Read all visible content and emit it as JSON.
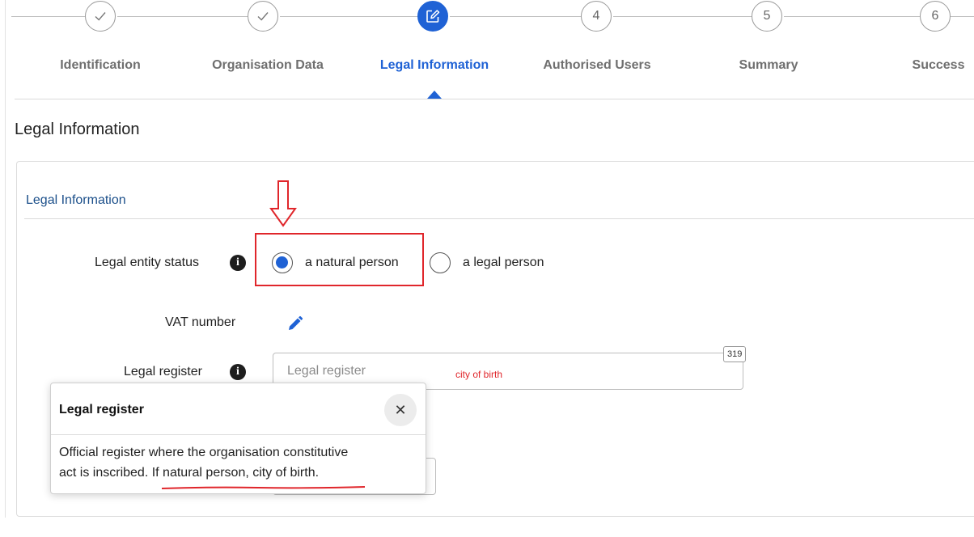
{
  "stepper": {
    "steps": [
      {
        "number": "",
        "label": "Identification",
        "state": "complete",
        "icon": "check-icon"
      },
      {
        "number": "",
        "label": "Organisation Data",
        "state": "complete",
        "icon": "check-icon"
      },
      {
        "number": "",
        "label": "Legal Information",
        "state": "active",
        "icon": "edit-icon"
      },
      {
        "number": "4",
        "label": "Authorised Users",
        "state": "pending"
      },
      {
        "number": "5",
        "label": "Summary",
        "state": "pending"
      },
      {
        "number": "6",
        "label": "Success",
        "state": "pending"
      }
    ],
    "active_color": "#1f62d5"
  },
  "page": {
    "title": "Legal Information"
  },
  "section": {
    "title": "Legal Information"
  },
  "legal_entity": {
    "label": "Legal entity status",
    "options": [
      {
        "label": "a natural person",
        "selected": true
      },
      {
        "label": "a legal person",
        "selected": false
      }
    ]
  },
  "vat": {
    "label": "VAT number",
    "icon": "pencil-icon"
  },
  "legal_register": {
    "label": "Legal register",
    "placeholder": "Legal register",
    "char_count": "319",
    "annotation": "city of birth"
  },
  "popover": {
    "title": "Legal register",
    "body_line1": "Official register where the organisation constitutive",
    "body_line2_start": "act is inscribed. ",
    "body_line2_end": "If natural person, city of birth.",
    "close_icon": "close-icon"
  },
  "colors": {
    "annotation_red": "#e0262b",
    "section_title": "#1b4f8a"
  }
}
